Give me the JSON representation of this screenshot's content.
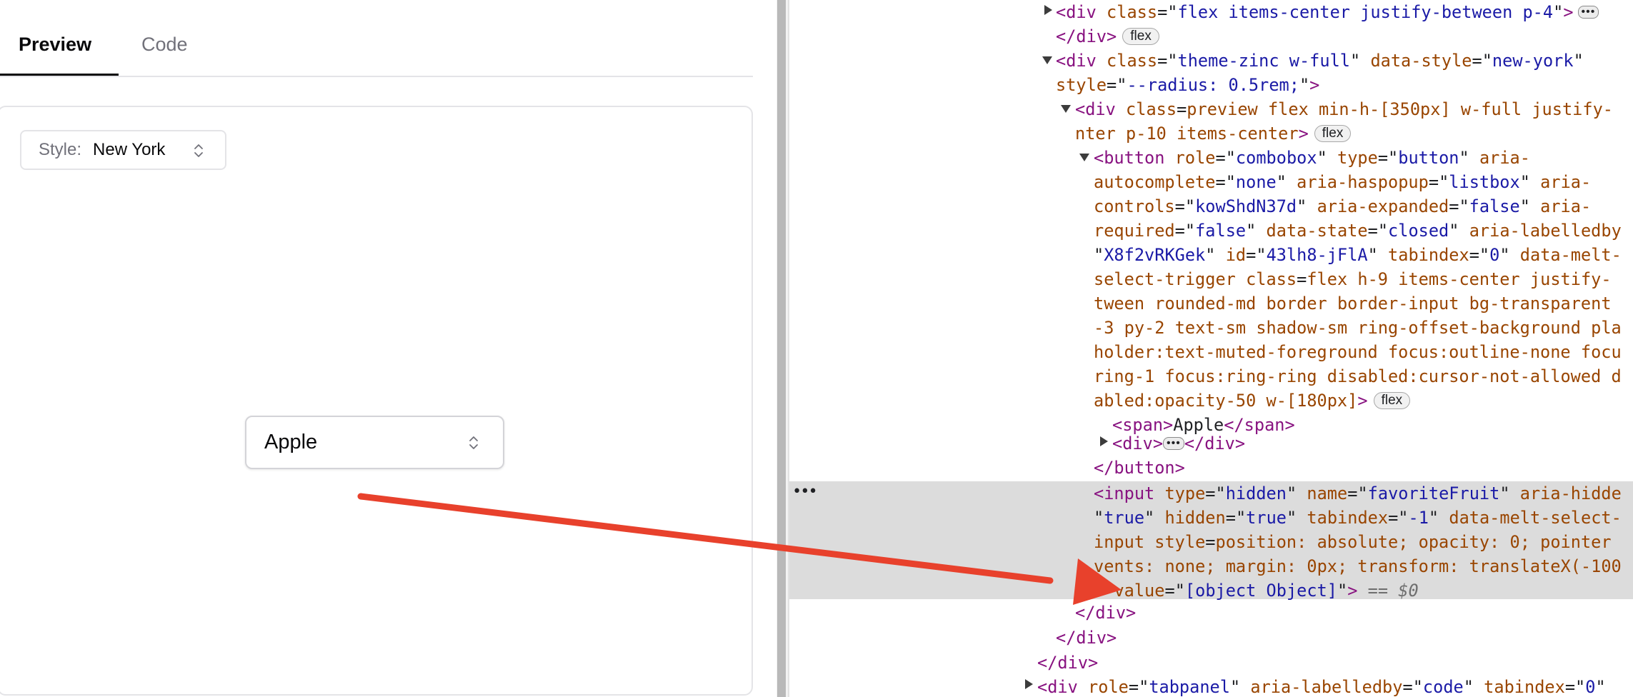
{
  "preview": {
    "tabs": [
      {
        "label": "Preview",
        "active": true
      },
      {
        "label": "Code",
        "active": false
      }
    ],
    "style_select": {
      "label": "Style:",
      "value": "New York",
      "icon": "chevron-up-down-icon"
    },
    "fruit_select": {
      "value": "Apple",
      "icon": "chevron-up-down-icon"
    }
  },
  "devtools": {
    "ellipsis": "•••",
    "colors": {
      "tag": "#881280",
      "attr_name": "#994500",
      "attr_value": "#1a1aa6",
      "selected_bg": "#dcdcdc",
      "arrow": "#e8412c"
    },
    "lines": [
      "<div class=\"flex items-center justify-between p-4\">",
      "</div>",
      "<div class=\"theme-zinc w-full\" data-style=\"new-york\"",
      "style=\"--radius: 0.5rem;\">",
      "<div class=\"preview flex min-h-[350px] w-full justify-",
      "nter p-10 items-center\">",
      "<button role=\"combobox\" type=\"button\" aria-",
      "autocomplete=\"none\" aria-haspopup=\"listbox\" aria-",
      "controls=\"kowShdN37d\" aria-expanded=\"false\" aria-",
      "required=\"false\" data-state=\"closed\" aria-labelledby",
      "\"X8f2vRKGek\" id=\"43lh8-jFlA\" tabindex=\"0\" data-melt-",
      "select-trigger class=\"flex h-9 items-center justify-",
      "tween rounded-md border border-input bg-transparent",
      "-3 py-2 text-sm shadow-sm ring-offset-background pla",
      "holder:text-muted-foreground focus:outline-none focu",
      "ring-1 focus:ring-ring disabled:cursor-not-allowed d",
      "abled:opacity-50 w-[180px]\">",
      "<span>Apple</span>",
      "<div>…</div>",
      "</button>",
      "<input type=\"hidden\" name=\"favoriteFruit\" aria-hidde",
      "\"true\" hidden=\"true\" tabindex=\"-1\" data-melt-select-",
      "input style=\"position: absolute; opacity: 0; pointer",
      "vents: none; margin: 0px; transform: translateX(-100",
      "\" value=\"[object Object]\"> == $0",
      "</div>",
      "</div>",
      "</div>",
      "<div role=\"tabpanel\" aria-labelledby=\"code\" tabindex=\"0\""
    ],
    "badges": {
      "flex": "flex",
      "dots": "•••"
    }
  }
}
